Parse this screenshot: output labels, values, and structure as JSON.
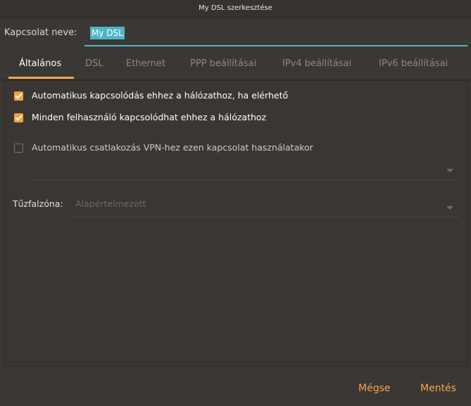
{
  "window": {
    "title": "My DSL szerkesztése"
  },
  "connection": {
    "name_label": "Kapcsolat neve:",
    "name_value": "My DSL"
  },
  "tabs": [
    {
      "label": "Általános",
      "active": true
    },
    {
      "label": "DSL",
      "active": false
    },
    {
      "label": "Ethernet",
      "active": false
    },
    {
      "label": "PPP beállításai",
      "active": false
    },
    {
      "label": "IPv4 beállításai",
      "active": false
    },
    {
      "label": "IPv6 beállításai",
      "active": false
    }
  ],
  "general": {
    "auto_connect": {
      "label": "Automatikus kapcsolódás ehhez a hálózathoz, ha elérhető",
      "checked": true
    },
    "all_users": {
      "label": "Minden felhasználó kapcsolódhat ehhez a hálózathoz",
      "checked": true
    },
    "vpn_auto": {
      "label": "Automatikus csatlakozás VPN-hez ezen kapcsolat használatakor",
      "checked": false
    },
    "vpn_select": {
      "value": ""
    },
    "firewall": {
      "label": "Tűzfalzóna:",
      "value": "Alapértelmezett"
    }
  },
  "footer": {
    "cancel_label": "Mégse",
    "save_label": "Mentés"
  },
  "colors": {
    "accent": "#f4a547",
    "highlight": "#4fb6c9",
    "background": "#3b3734"
  }
}
